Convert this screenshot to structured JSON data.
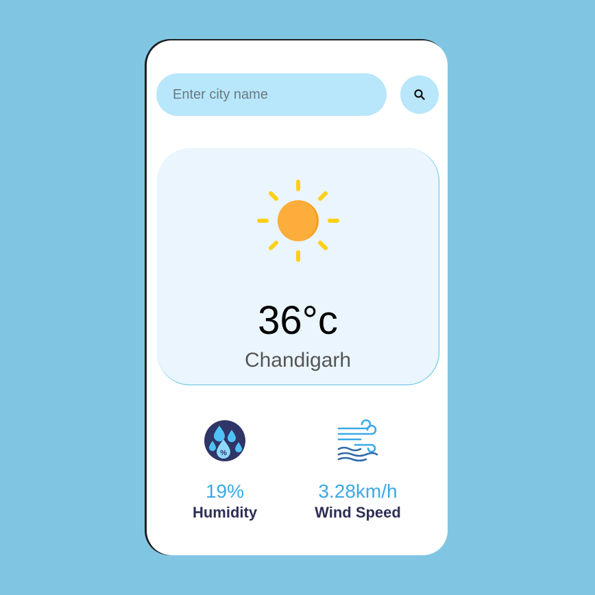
{
  "search": {
    "placeholder": "Enter city name",
    "value": "",
    "button_icon": "search-icon"
  },
  "weather": {
    "icon": "sun-icon",
    "temperature": "36°c",
    "city": "Chandigarh"
  },
  "stats": {
    "humidity": {
      "icon": "humidity-icon",
      "value": "19%",
      "label": "Humidity"
    },
    "wind": {
      "icon": "wind-icon",
      "value": "3.28km/h",
      "label": "Wind Speed"
    }
  },
  "colors": {
    "background": "#80c6e3",
    "input_background": "#b8e6fa",
    "panel_background": "#eaf5fd",
    "value_color": "#3aa9e6",
    "label_color": "#2e2e55",
    "sun_color": "#fdad3b",
    "ray_color": "#fdd017"
  }
}
